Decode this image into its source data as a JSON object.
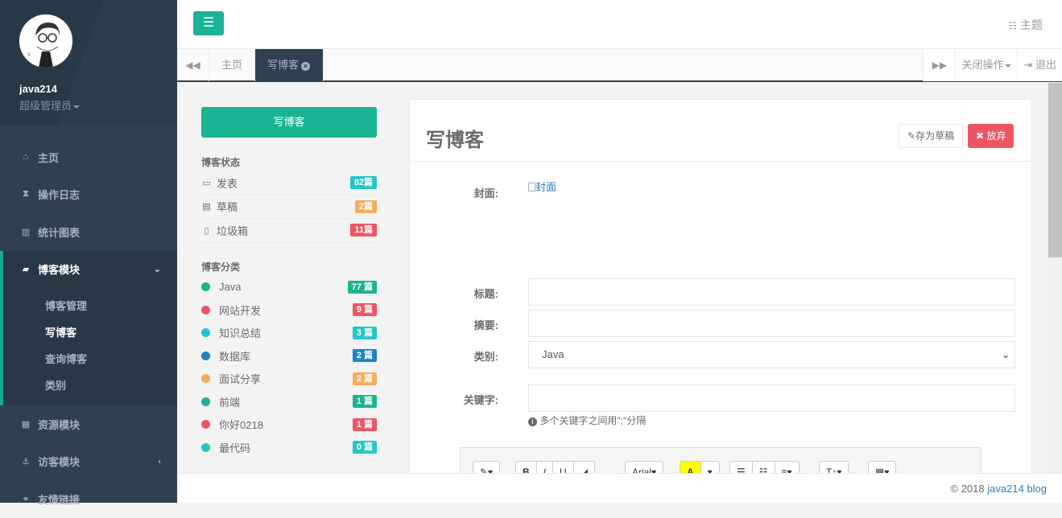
{
  "sidebar": {
    "user_name": "java214",
    "user_role": "超级管理员",
    "nav": [
      {
        "label": "主页",
        "icon": "home-icon"
      },
      {
        "label": "操作日志",
        "icon": "hourglass-icon"
      },
      {
        "label": "统计图表",
        "icon": "bar-chart-icon"
      },
      {
        "label": "博客模块",
        "icon": "book-icon"
      },
      {
        "label": "资源模块",
        "icon": "table-icon"
      },
      {
        "label": "访客模块",
        "icon": "anchor-icon"
      },
      {
        "label": "友情链接",
        "icon": "link-icon"
      }
    ],
    "blog_submenu": [
      "博客管理",
      "写博客",
      "查询博客",
      "类别"
    ]
  },
  "topbar": {
    "theme_label": "主题"
  },
  "tabs": {
    "items": [
      "主页",
      "写博客"
    ],
    "close_ops": "关闭操作",
    "logout": "退出"
  },
  "left_panel": {
    "write_button": "写博客",
    "status_title": "博客状态",
    "status": [
      {
        "label": "发表",
        "count": "82篇",
        "color": "#23c6c8",
        "icon": "inbox-icon"
      },
      {
        "label": "草稿",
        "count": "2篇",
        "color": "#f8ac59",
        "icon": "file-icon"
      },
      {
        "label": "垃圾箱",
        "count": "11篇",
        "color": "#ed5565",
        "icon": "trash-icon"
      }
    ],
    "category_title": "博客分类",
    "categories": [
      {
        "label": "Java",
        "count": "77 篇",
        "color": "#1ab394"
      },
      {
        "label": "网站开发",
        "count": "9 篇",
        "color": "#ed5565"
      },
      {
        "label": "知识总结",
        "count": "3 篇",
        "color": "#23c6c8"
      },
      {
        "label": "数据库",
        "count": "2 篇",
        "color": "#1c84c6"
      },
      {
        "label": "面试分享",
        "count": "2 篇",
        "color": "#f8ac59"
      },
      {
        "label": "前端",
        "count": "1 篇",
        "color": "#1ab394"
      },
      {
        "label": "你好0218",
        "count": "1 篇",
        "color": "#ed5565"
      },
      {
        "label": "最代码",
        "count": "0 篇",
        "color": "#23c6c8"
      }
    ]
  },
  "editor_panel": {
    "title": "写博客",
    "save_draft": "存为草稿",
    "discard": "放弃",
    "cover_label": "封面:",
    "cover_alt": "封面",
    "title_label": "标题:",
    "summary_label": "摘要:",
    "category_label": "类别:",
    "category_value": "Java",
    "keywords_label": "关键字:",
    "keywords_hint": "多个关键字之间用\";\"分隔",
    "toolbar_font": "Arial"
  },
  "footer": {
    "copyright": "© 2018",
    "link": "java214 blog"
  }
}
